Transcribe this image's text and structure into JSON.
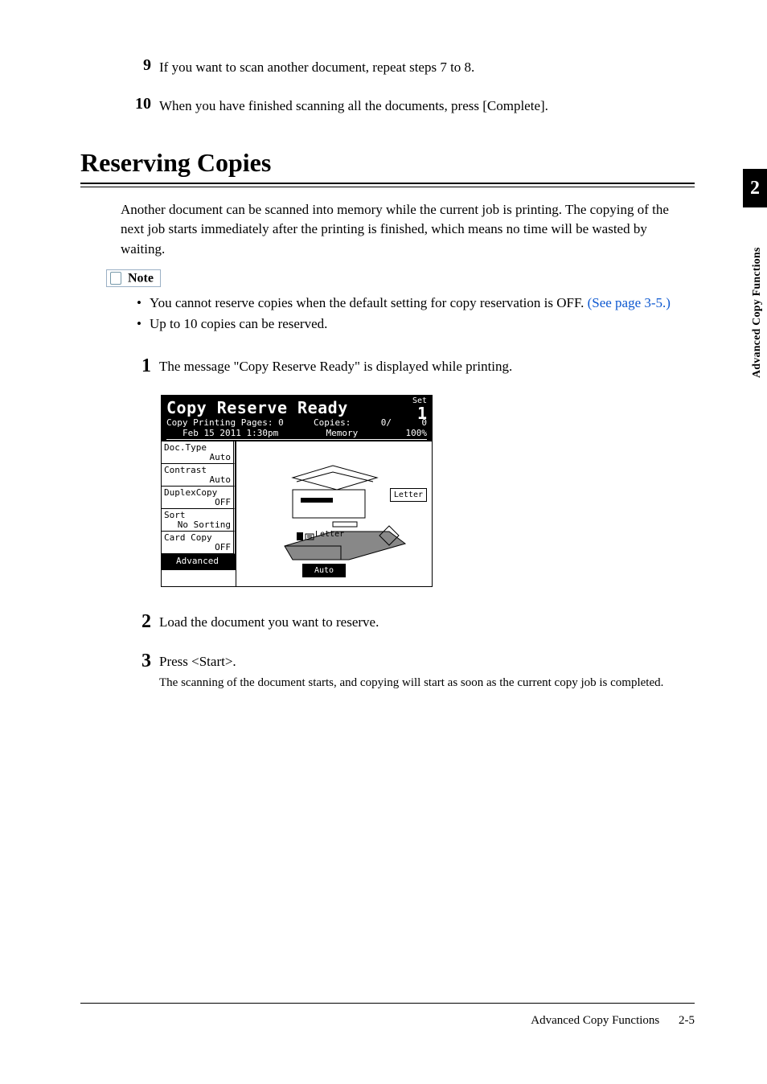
{
  "steps_top": [
    {
      "num": "9",
      "text": "If you want to scan another document, repeat steps 7 to 8."
    },
    {
      "num": "10",
      "text": "When you have finished scanning all the documents, press [Complete]."
    }
  ],
  "heading": "Reserving Copies",
  "intro": "Another document can be scanned into memory while the current job is printing. The copying of the next job starts immediately after the printing is finished, which means no time will be wasted by waiting.",
  "note_label": "Note",
  "bullets": [
    {
      "text": "You cannot reserve copies when the default setting for copy reservation is OFF. ",
      "link": "(See page 3-5.)"
    },
    {
      "text": "Up to 10 copies can be reserved.",
      "link": ""
    }
  ],
  "steps_main": [
    {
      "num": "1",
      "text": "The message \"Copy Reserve Ready\" is displayed while printing.",
      "note": ""
    },
    {
      "num": "2",
      "text": "Load the document you want to reserve.",
      "note": ""
    },
    {
      "num": "3",
      "text": "Press <Start>.",
      "note": "The scanning of the document starts, and copying will start as soon as the current copy job is completed."
    }
  ],
  "lcd": {
    "title": "Copy Reserve Ready",
    "set_label": "Set",
    "set_value": "1",
    "line2_left": "Copy Printing Pages:  0",
    "line2_mid": "Copies:",
    "line2_right1": "0/",
    "line2_right2": "0",
    "line3_left": "Feb 15 2011  1:30pm",
    "line3_mid": "Memory",
    "line3_right": "100%",
    "buttons": [
      {
        "label": "Doc.Type",
        "value": "Auto"
      },
      {
        "label": "Contrast",
        "value": "Auto"
      },
      {
        "label": "DuplexCopy",
        "value": "OFF"
      },
      {
        "label": "Sort",
        "value": "No Sorting"
      },
      {
        "label": "Card Copy",
        "value": "OFF"
      }
    ],
    "advanced": "Advanced",
    "size_letter": "Letter",
    "mid_letter": "Letter",
    "auto": "Auto"
  },
  "side": {
    "chapter": "2",
    "label": "Advanced Copy Functions"
  },
  "footer": {
    "text": "Advanced Copy Functions",
    "page": "2-5"
  }
}
